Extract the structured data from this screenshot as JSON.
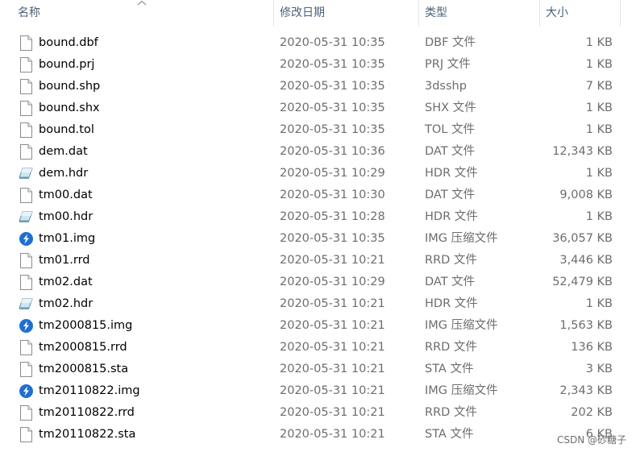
{
  "columns": {
    "name": "名称",
    "date": "修改日期",
    "type": "类型",
    "size": "大小"
  },
  "files": [
    {
      "name": "bound.dbf",
      "date": "2020-05-31 10:35",
      "type": "DBF 文件",
      "size": "1 KB",
      "icon": "file-icon"
    },
    {
      "name": "bound.prj",
      "date": "2020-05-31 10:35",
      "type": "PRJ 文件",
      "size": "1 KB",
      "icon": "file-icon"
    },
    {
      "name": "bound.shp",
      "date": "2020-05-31 10:35",
      "type": "3dsshp",
      "size": "7 KB",
      "icon": "file-icon"
    },
    {
      "name": "bound.shx",
      "date": "2020-05-31 10:35",
      "type": "SHX 文件",
      "size": "1 KB",
      "icon": "file-icon"
    },
    {
      "name": "bound.tol",
      "date": "2020-05-31 10:35",
      "type": "TOL 文件",
      "size": "1 KB",
      "icon": "file-icon"
    },
    {
      "name": "dem.dat",
      "date": "2020-05-31 10:36",
      "type": "DAT 文件",
      "size": "12,343 KB",
      "icon": "file-icon"
    },
    {
      "name": "dem.hdr",
      "date": "2020-05-31 10:29",
      "type": "HDR 文件",
      "size": "1 KB",
      "icon": "hdr-file-icon"
    },
    {
      "name": "tm00.dat",
      "date": "2020-05-31 10:30",
      "type": "DAT 文件",
      "size": "9,008 KB",
      "icon": "file-icon"
    },
    {
      "name": "tm00.hdr",
      "date": "2020-05-31 10:28",
      "type": "HDR 文件",
      "size": "1 KB",
      "icon": "hdr-file-icon"
    },
    {
      "name": "tm01.img",
      "date": "2020-05-31 10:35",
      "type": "IMG 压缩文件",
      "size": "36,057 KB",
      "icon": "img-archive-icon"
    },
    {
      "name": "tm01.rrd",
      "date": "2020-05-31 10:21",
      "type": "RRD 文件",
      "size": "3,446 KB",
      "icon": "file-icon"
    },
    {
      "name": "tm02.dat",
      "date": "2020-05-31 10:29",
      "type": "DAT 文件",
      "size": "52,479 KB",
      "icon": "file-icon"
    },
    {
      "name": "tm02.hdr",
      "date": "2020-05-31 10:21",
      "type": "HDR 文件",
      "size": "1 KB",
      "icon": "hdr-file-icon"
    },
    {
      "name": "tm2000815.img",
      "date": "2020-05-31 10:21",
      "type": "IMG 压缩文件",
      "size": "1,563 KB",
      "icon": "img-archive-icon"
    },
    {
      "name": "tm2000815.rrd",
      "date": "2020-05-31 10:21",
      "type": "RRD 文件",
      "size": "136 KB",
      "icon": "file-icon"
    },
    {
      "name": "tm2000815.sta",
      "date": "2020-05-31 10:21",
      "type": "STA 文件",
      "size": "3 KB",
      "icon": "file-icon"
    },
    {
      "name": "tm20110822.img",
      "date": "2020-05-31 10:21",
      "type": "IMG 压缩文件",
      "size": "2,343 KB",
      "icon": "img-archive-icon"
    },
    {
      "name": "tm20110822.rrd",
      "date": "2020-05-31 10:21",
      "type": "RRD 文件",
      "size": "202 KB",
      "icon": "file-icon"
    },
    {
      "name": "tm20110822.sta",
      "date": "2020-05-31 10:21",
      "type": "STA 文件",
      "size": "6 KB",
      "icon": "file-icon"
    }
  ],
  "watermark": "CSDN @砂糖子",
  "colors": {
    "header_text": "#4c607a",
    "secondary_text": "#6d6d6d",
    "archive_blue": "#1f6fd1"
  }
}
